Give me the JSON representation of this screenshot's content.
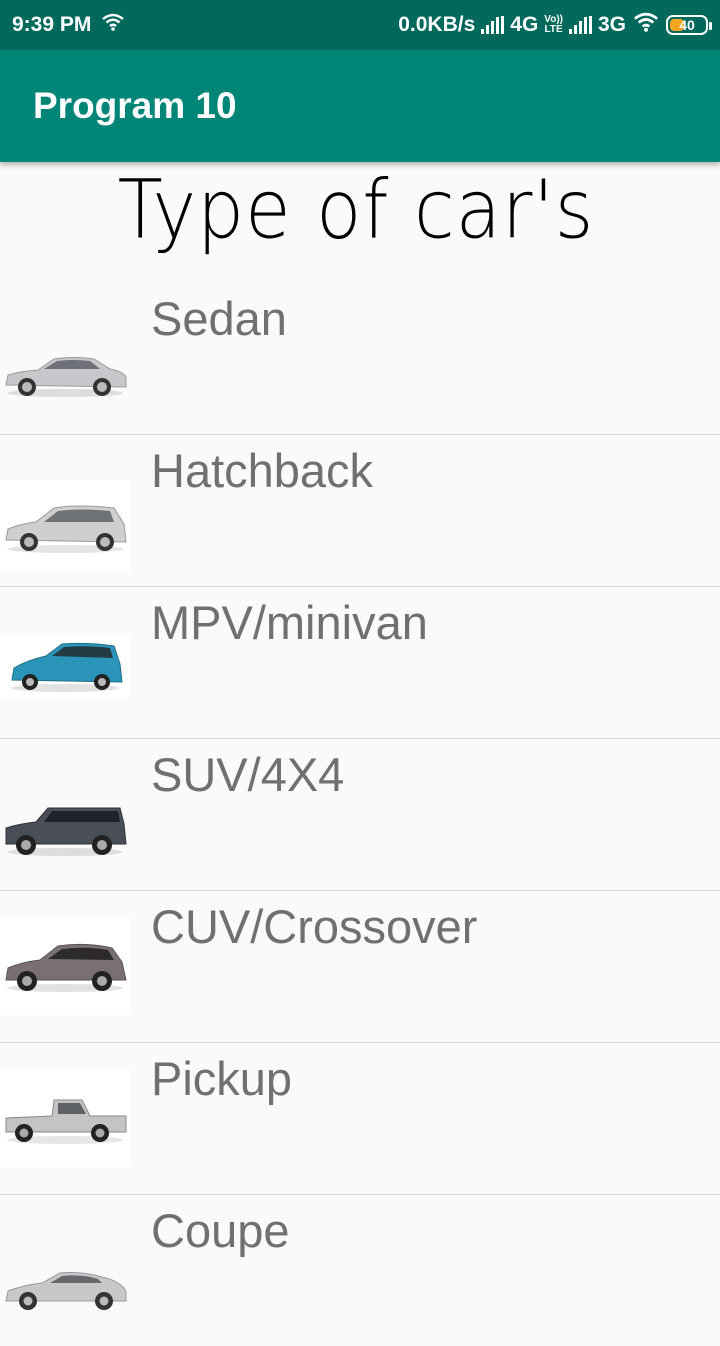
{
  "status_bar": {
    "time": "9:39 PM",
    "network_speed": "0.0KB/s",
    "network_1": "4G",
    "volte_top": "Vo))",
    "volte_bottom": "LTE",
    "network_2": "3G",
    "battery": "40",
    "battery_level": 0.4,
    "icons": [
      "wifi-icon",
      "signal-icon",
      "signal-icon",
      "wifi-icon",
      "battery-icon"
    ]
  },
  "app_bar": {
    "title": "Program 10"
  },
  "heading": "Type of car's",
  "cars": [
    {
      "label": "Sedan",
      "color": "#c8c8cc"
    },
    {
      "label": "Hatchback",
      "color": "#cfcfcf"
    },
    {
      "label": "MPV/minivan",
      "color": "#2a95b8"
    },
    {
      "label": "SUV/4X4",
      "color": "#4a4e58"
    },
    {
      "label": "CUV/Crossover",
      "color": "#7b7071"
    },
    {
      "label": "Pickup",
      "color": "#c4c4c4"
    },
    {
      "label": "Coupe",
      "color": "#c8c8c8"
    }
  ]
}
